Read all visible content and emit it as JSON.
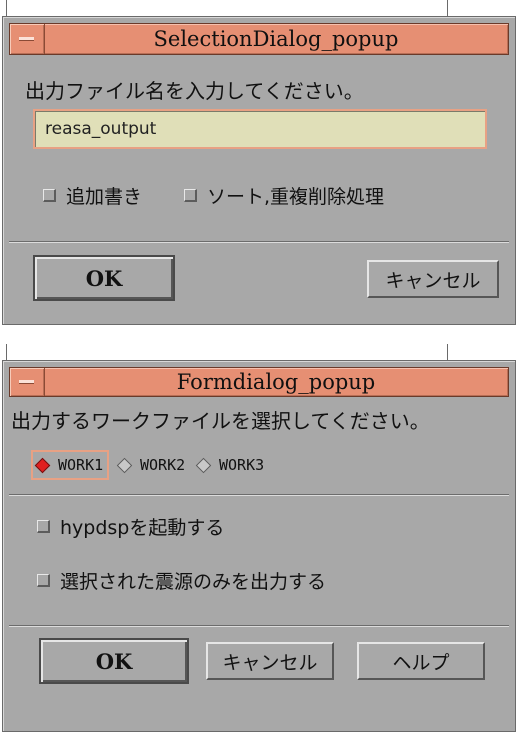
{
  "selection_dialog": {
    "title": "SelectionDialog_popup",
    "prompt": "出力ファイル名を入力してください。",
    "filename_value": "reasa_output",
    "check_append": "追加書き",
    "check_sort": "ソート,重複削除処理",
    "ok_label": "OK",
    "cancel_label": "キャンセル"
  },
  "form_dialog": {
    "title": "Formdialog_popup",
    "prompt": "出力するワークファイルを選択してください。",
    "radios": [
      {
        "label": "WORK1",
        "selected": true
      },
      {
        "label": "WORK2",
        "selected": false
      },
      {
        "label": "WORK3",
        "selected": false
      }
    ],
    "check_hypdsp": "hypdspを起動する",
    "check_selected_only": "選択された震源のみを出力する",
    "ok_label": "OK",
    "cancel_label": "キャンセル",
    "help_label": "ヘルプ"
  },
  "colors": {
    "titlebar": "#e68f73",
    "window_bg": "#a8a8a8",
    "textfield_bg": "#e0dfb8",
    "radio_selected": "#e02020"
  }
}
